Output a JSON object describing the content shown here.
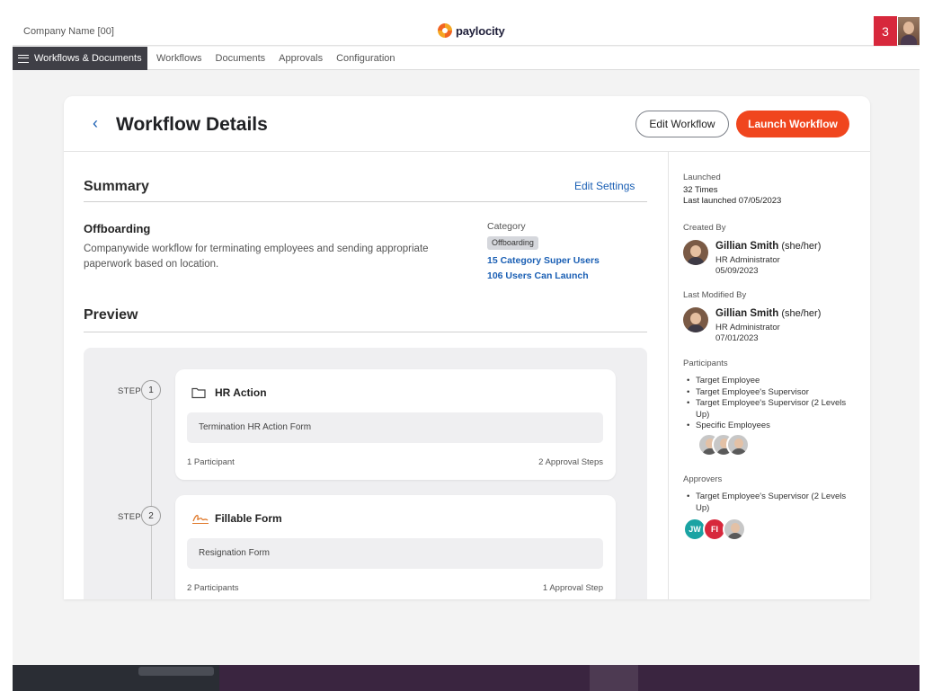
{
  "topbar": {
    "company_name": "Company Name [00]",
    "logo_text": "paylocity",
    "notification_count": "3"
  },
  "nav": {
    "main_label": "Workflows & Documents",
    "links": [
      "Workflows",
      "Documents",
      "Approvals",
      "Configuration"
    ]
  },
  "header": {
    "title": "Workflow Details",
    "edit_button": "Edit Workflow",
    "launch_button": "Launch Workflow"
  },
  "summary": {
    "title": "Summary",
    "edit_settings": "Edit Settings",
    "workflow_name": "Offboarding",
    "description": "Companywide workflow  for terminating employees and sending appropriate paperwork based on location.",
    "category_label": "Category",
    "category_value": "Offboarding",
    "super_users": "15 Category Super Users",
    "can_launch": "106 Users Can Launch"
  },
  "preview": {
    "title": "Preview",
    "step_word": "STEP",
    "steps": [
      {
        "number": "1",
        "name": "HR Action",
        "form": "Termination HR Action Form",
        "participants": "1 Participant",
        "approvals": "2 Approval Steps",
        "icon": "folder-icon"
      },
      {
        "number": "2",
        "name": "Fillable Form",
        "form": "Resignation Form",
        "participants": "2 Participants",
        "approvals": "1 Approval Step",
        "icon": "signature-icon"
      }
    ]
  },
  "sidebar": {
    "launched_label": "Launched",
    "launched_times": "32 Times",
    "last_launched": "Last launched 07/05/2023",
    "created_by_label": "Created By",
    "created_by": {
      "name": "Gillian Smith",
      "pronoun": "(she/her)",
      "role": "HR Administrator",
      "date": "05/09/2023"
    },
    "modified_by_label": "Last Modified By",
    "modified_by": {
      "name": "Gillian Smith",
      "pronoun": "(she/her)",
      "role": "HR Administrator",
      "date": "07/01/2023"
    },
    "participants_label": "Participants",
    "participants": [
      "Target Employee",
      "Target Employee's Supervisor",
      "Target Employee's Supervisor (2 Levels Up)",
      "Specific Employees"
    ],
    "approvers_label": "Approvers",
    "approvers": [
      "Target Employee's Supervisor (2 Levels Up)"
    ],
    "approver_initials": [
      "JW",
      "FI"
    ]
  },
  "colors": {
    "accent": "#f0461e",
    "link": "#1a5fb4",
    "notification": "#d7283c",
    "initials_jw": "#1aa3a3",
    "initials_fi": "#d7283c"
  }
}
